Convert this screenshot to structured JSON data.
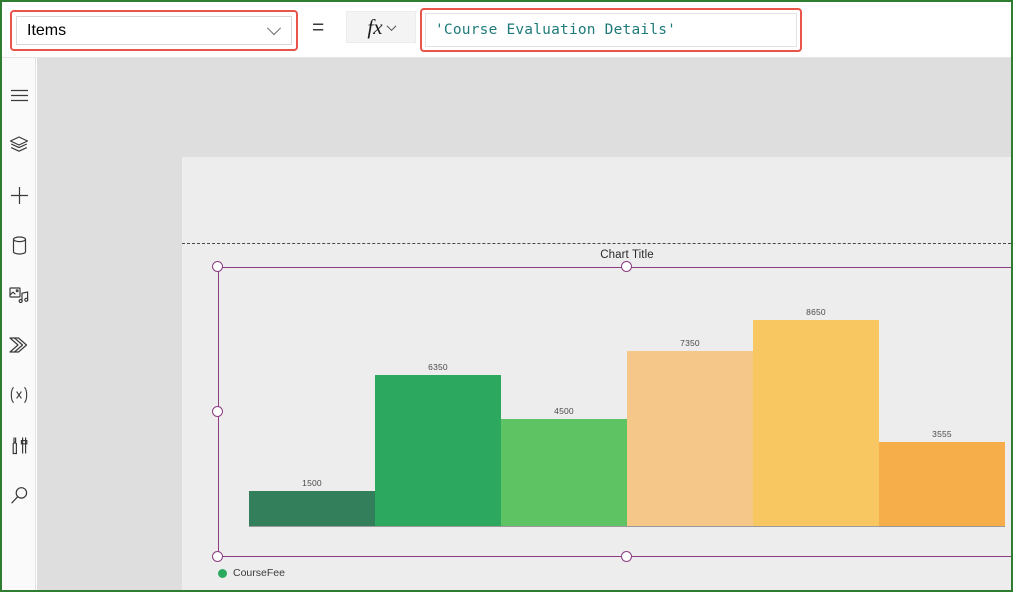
{
  "formula_bar": {
    "property_dropdown": {
      "value": "Items",
      "chevron_icon": "chevron-down-icon"
    },
    "equals": "=",
    "fx": {
      "glyph": "fx",
      "chevron_icon": "chevron-down-icon"
    },
    "formula": "'Course Evaluation Details'"
  },
  "left_rail": {
    "items": [
      {
        "name": "menu",
        "icon": "hamburger-menu-icon"
      },
      {
        "name": "tree-view",
        "icon": "layers-icon"
      },
      {
        "name": "insert",
        "icon": "plus-icon"
      },
      {
        "name": "data",
        "icon": "database-icon"
      },
      {
        "name": "media",
        "icon": "media-icon"
      },
      {
        "name": "power-automate",
        "icon": "power-automate-icon"
      },
      {
        "name": "variables",
        "icon": "variables-x-icon"
      },
      {
        "name": "tools",
        "icon": "tools-icon"
      },
      {
        "name": "search",
        "icon": "search-icon"
      }
    ]
  },
  "canvas": {
    "selection_color": "#8b3d82",
    "handles": [
      "top-left",
      "top-center",
      "top-right",
      "middle-left",
      "middle-right",
      "bottom-left",
      "bottom-center",
      "bottom-right"
    ]
  },
  "chart_data": {
    "type": "bar",
    "title": "Chart Title",
    "xlabel": "",
    "ylabel": "",
    "grid": false,
    "legend_position": "bottom-left",
    "legend": [
      "CourseFee"
    ],
    "categories": [
      "",
      "",
      "",
      "",
      "",
      ""
    ],
    "values": [
      1500,
      6350,
      4500,
      7350,
      8650,
      3555
    ],
    "labels": [
      "1500",
      "6350",
      "4500",
      "7350",
      "8650",
      "3555"
    ],
    "colors": [
      "#337f5c",
      "#2da95f",
      "#5ec463",
      "#f5c88a",
      "#f8c762",
      "#f5ae4a"
    ],
    "ylim": [
      0,
      9600
    ],
    "series": [
      {
        "name": "CourseFee",
        "values": [
          1500,
          6350,
          4500,
          7350,
          8650,
          3555
        ]
      }
    ]
  }
}
